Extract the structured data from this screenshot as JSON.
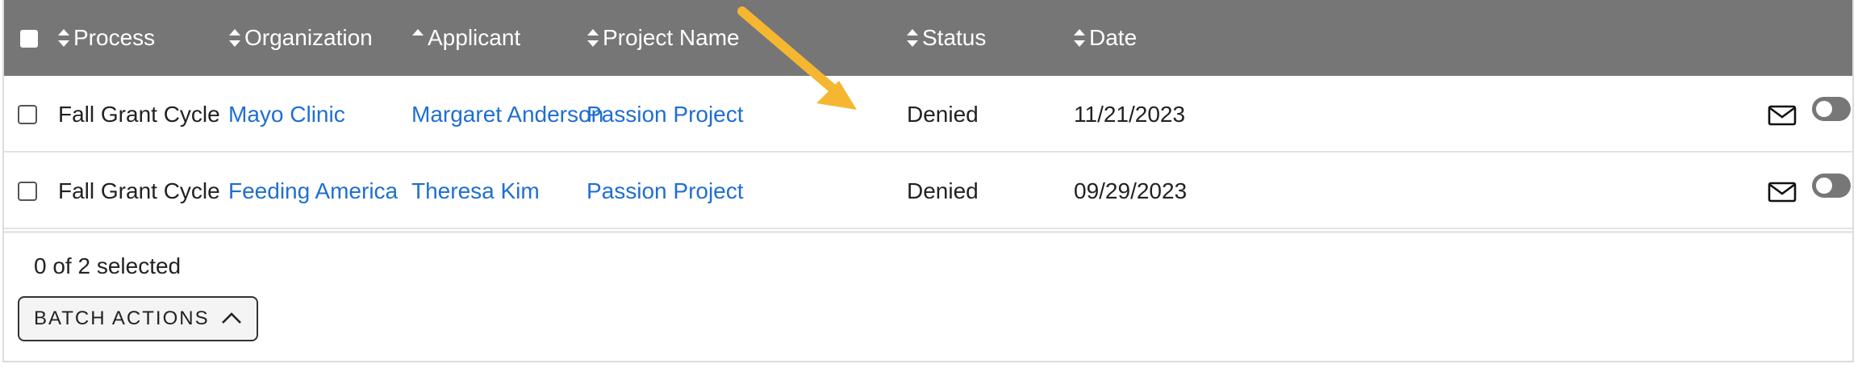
{
  "table": {
    "columns": [
      {
        "key": "process",
        "label": "Process",
        "sort": "both"
      },
      {
        "key": "organization",
        "label": "Organization",
        "sort": "both"
      },
      {
        "key": "applicant",
        "label": "Applicant",
        "sort": "asc"
      },
      {
        "key": "project_name",
        "label": "Project Name",
        "sort": "both"
      },
      {
        "key": "status",
        "label": "Status",
        "sort": "both"
      },
      {
        "key": "date",
        "label": "Date",
        "sort": "both"
      }
    ],
    "rows": [
      {
        "process": "Fall Grant Cycle",
        "organization": "Mayo Clinic",
        "applicant": "Margaret Anderson",
        "project_name": "Passion Project",
        "status": "Denied",
        "date": "11/21/2023",
        "selected": false,
        "toggle_on": false
      },
      {
        "process": "Fall Grant Cycle",
        "organization": "Feeding America",
        "applicant": "Theresa Kim",
        "project_name": "Passion Project",
        "status": "Denied",
        "date": "09/29/2023",
        "selected": false,
        "toggle_on": false
      }
    ]
  },
  "footer": {
    "selected_text": "0 of 2 selected",
    "batch_actions_label": "BATCH ACTIONS"
  },
  "colors": {
    "header_bg": "#767676",
    "link": "#1f6fcf",
    "annotation_arrow": "#f5b731"
  },
  "icons": {
    "sort_both": "sort-icon",
    "sort_asc": "sort-asc-icon",
    "row_action": "mail-icon",
    "toggle": "toggle-switch",
    "batch_chevron": "chevron-up-icon",
    "annotation": "arrow-annotation"
  }
}
